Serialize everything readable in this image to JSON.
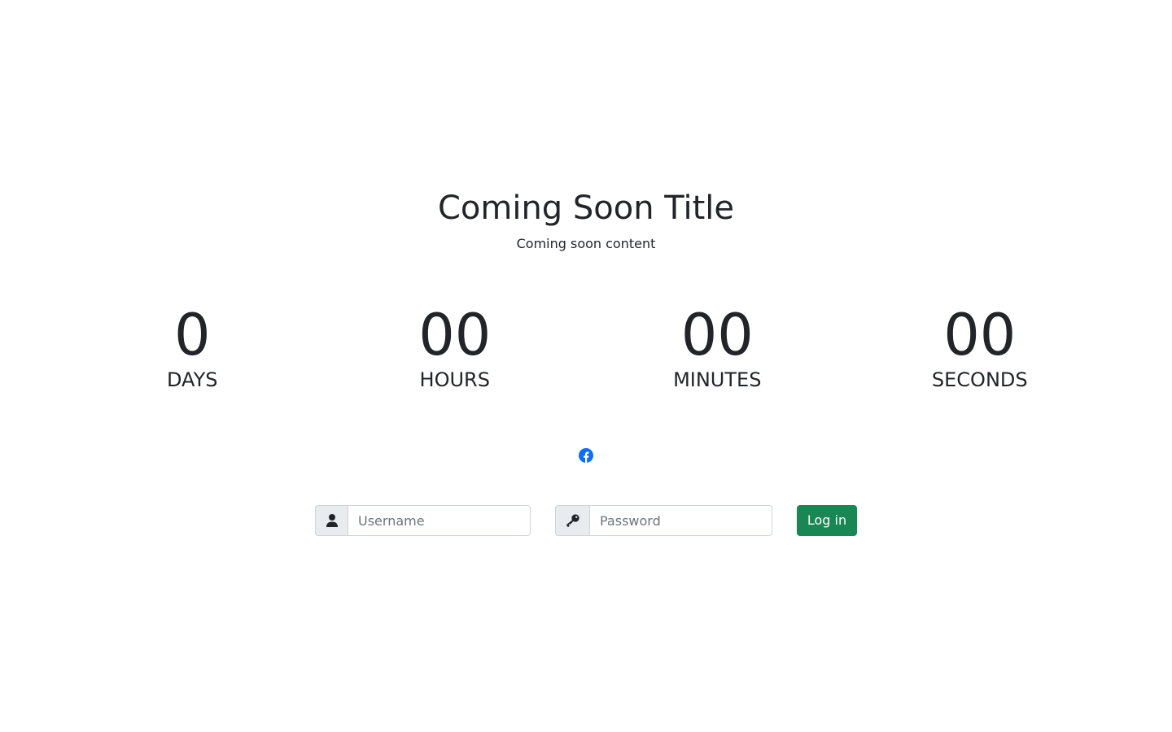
{
  "hero": {
    "title": "Coming Soon Title",
    "subtitle": "Coming soon content"
  },
  "countdown": {
    "units": [
      {
        "value": "0",
        "label": "DAYS"
      },
      {
        "value": "00",
        "label": "HOURS"
      },
      {
        "value": "00",
        "label": "MINUTES"
      },
      {
        "value": "00",
        "label": "SECONDS"
      }
    ]
  },
  "social": {
    "icon": "facebook-icon",
    "color": "#0d6efd"
  },
  "login": {
    "username_icon": "user-icon",
    "username_placeholder": "Username",
    "password_icon": "key-icon",
    "password_placeholder": "Password",
    "submit_label": "Log in",
    "submit_color": "#198754"
  }
}
